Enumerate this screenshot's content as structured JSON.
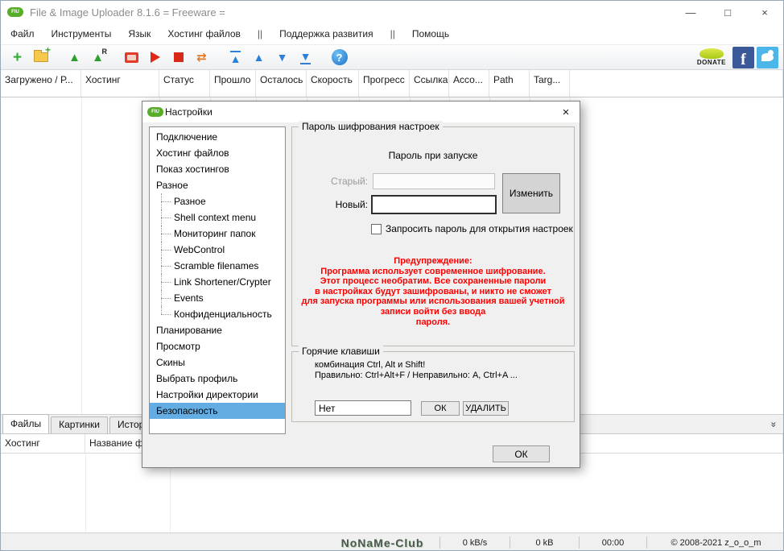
{
  "titlebar": {
    "logo": "FIU",
    "title": "File & Image Uploader 8.1.6  = Freeware ="
  },
  "icons": {
    "minimize": "—",
    "maximize": "□",
    "close": "×",
    "add": "+",
    "folder_add": "+",
    "upload": "▲",
    "upload_r": "▲",
    "r_badge": "R",
    "swap": "⇄",
    "move_top": "▲",
    "move_up": "▲",
    "move_down": "▼",
    "move_bottom": "▼",
    "help": "?",
    "facebook": "f",
    "chevron": "»",
    "dialog_close": "×"
  },
  "menubar": {
    "items": [
      "Файл",
      "Инструменты",
      "Язык",
      "Хостинг файлов",
      "||",
      "Поддержка развития",
      "||",
      "Помощь"
    ]
  },
  "toolbar": {
    "donate_label": "DONATE"
  },
  "columns": [
    "Загружено / Р...",
    "Хостинг",
    "Статус",
    "Прошло",
    "Осталось",
    "Скорость",
    "Прогресс",
    "Ссылка",
    "Ассо...",
    "Path",
    "Targ..."
  ],
  "bottom": {
    "tabs": [
      "Файлы",
      "Картинки",
      "История заг..."
    ],
    "columns": [
      "Хостинг",
      "Название фа..."
    ]
  },
  "statusbar": {
    "watermark": "NoNaMe-Club",
    "speed": "0 kB/s",
    "size": "0 kB",
    "time": "00:00",
    "copyright": "© 2008-2021 z_o_o_m"
  },
  "dialog": {
    "title": "Настройки",
    "tree": [
      {
        "label": "Подключение"
      },
      {
        "label": "Хостинг файлов"
      },
      {
        "label": "Показ хостингов"
      },
      {
        "label": "Разное"
      },
      {
        "label": "Разное"
      },
      {
        "label": "Shell context menu"
      },
      {
        "label": "Мониторинг папок"
      },
      {
        "label": "WebControl"
      },
      {
        "label": "Scramble filenames"
      },
      {
        "label": "Link Shortener/Crypter"
      },
      {
        "label": "Events"
      },
      {
        "label": "Конфиденциальность"
      },
      {
        "label": "Планирование"
      },
      {
        "label": "Просмотр"
      },
      {
        "label": "Скины"
      },
      {
        "label": "Выбрать профиль"
      },
      {
        "label": "Настройки директории"
      },
      {
        "label": "Безопасность"
      }
    ],
    "password": {
      "group_title": "Пароль шифрования настроек",
      "header": "Пароль при запуске",
      "old_label": "Старый:",
      "new_label": "Новый:",
      "change_button": "Изменить",
      "checkbox_label": "Запросить пароль для открытия настроек",
      "warning_title": "Предупреждение:",
      "warning_lines": [
        "Программа использует современное шифрование.",
        "Этот процесс необратим. Все сохраненные пароли",
        "в настройках будут зашифрованы, и никто не сможет",
        "для запуска программы или использования вашей учетной",
        "записи войти без ввода",
        "пароля."
      ]
    },
    "hotkeys": {
      "group_title": "Горячие клавиши",
      "line1": "комбинация Ctrl, Alt и Shift!",
      "line2": "Правильно: Ctrl+Alt+F / Неправильно: A, Ctrl+A ...",
      "input_value": "Нет",
      "ok_button": "ОК",
      "delete_button": "УДАЛИТЬ"
    },
    "ok_button": "ОК"
  }
}
